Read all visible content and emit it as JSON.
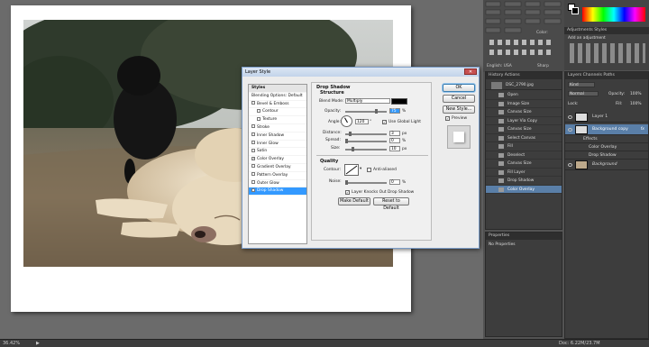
{
  "dialog": {
    "title": "Layer Style",
    "styles_header": "Styles",
    "style_items": [
      {
        "label": "Blending Options: Default",
        "checkbox": false,
        "checked": false,
        "sub": false,
        "active": false
      },
      {
        "label": "Bevel & Emboss",
        "checkbox": true,
        "checked": false,
        "sub": false,
        "active": false
      },
      {
        "label": "Contour",
        "checkbox": true,
        "checked": false,
        "sub": true,
        "active": false
      },
      {
        "label": "Texture",
        "checkbox": true,
        "checked": false,
        "sub": true,
        "active": false
      },
      {
        "label": "Stroke",
        "checkbox": true,
        "checked": false,
        "sub": false,
        "active": false
      },
      {
        "label": "Inner Shadow",
        "checkbox": true,
        "checked": false,
        "sub": false,
        "active": false
      },
      {
        "label": "Inner Glow",
        "checkbox": true,
        "checked": false,
        "sub": false,
        "active": false
      },
      {
        "label": "Satin",
        "checkbox": true,
        "checked": false,
        "sub": false,
        "active": false
      },
      {
        "label": "Color Overlay",
        "checkbox": true,
        "checked": true,
        "sub": false,
        "active": false
      },
      {
        "label": "Gradient Overlay",
        "checkbox": true,
        "checked": false,
        "sub": false,
        "active": false
      },
      {
        "label": "Pattern Overlay",
        "checkbox": true,
        "checked": false,
        "sub": false,
        "active": false
      },
      {
        "label": "Outer Glow",
        "checkbox": true,
        "checked": false,
        "sub": false,
        "active": false
      },
      {
        "label": "Drop Shadow",
        "checkbox": true,
        "checked": true,
        "sub": false,
        "active": true
      }
    ],
    "drop_shadow": {
      "group_title": "Drop Shadow",
      "structure_title": "Structure",
      "blend_mode_label": "Blend Mode:",
      "blend_mode_value": "Multiply",
      "opacity_label": "Opacity:",
      "opacity_value": "75",
      "opacity_unit": "%",
      "opacity_fraction": 0.75,
      "angle_label": "Angle:",
      "angle_value": "120",
      "angle_unit": "°",
      "use_global_light_label": "Use Global Light",
      "distance_label": "Distance:",
      "distance_value": "3",
      "distance_unit": "px",
      "distance_fraction": 0.1,
      "spread_label": "Spread:",
      "spread_value": "0",
      "spread_unit": "%",
      "size_label": "Size:",
      "size_value": "10",
      "size_unit": "px",
      "size_fraction": 0.15,
      "quality_title": "Quality",
      "contour_label": "Contour:",
      "anti_aliased_label": "Anti-aliased",
      "noise_label": "Noise:",
      "noise_value": "0",
      "noise_unit": "%",
      "knockout_label": "Layer Knocks Out Drop Shadow",
      "make_default": "Make Default",
      "reset_default": "Reset to Default"
    },
    "buttons": {
      "ok": "OK",
      "cancel": "Cancel",
      "new_style": "New Style...",
      "preview": "Preview"
    }
  },
  "history": {
    "tabs": "History   Actions",
    "snapshot": "DSC_2790.jpg",
    "items": [
      "Open",
      "Image Size",
      "Canvas Size",
      "Layer Via Copy",
      "Canvas Size",
      "Select Canvas",
      "Fill",
      "Deselect",
      "Canvas Size",
      "Fill Layer",
      "Drop Shadow",
      "Color Overlay"
    ],
    "selected_index": 11
  },
  "properties": {
    "tab": "Properties",
    "text": "No Properties"
  },
  "adjustments": {
    "tabs": "Adjustments   Styles",
    "title": "Add an adjustment"
  },
  "layers": {
    "tabs": "Layers   Channels   Paths",
    "kind_label": "Kind",
    "mode_value": "Normal",
    "opacity_label": "Opacity:",
    "opacity_value": "100%",
    "lock_label": "Lock:",
    "fill_label": "Fill:",
    "fill_value": "100%",
    "rows": [
      {
        "label": "Layer 1",
        "selected": false
      },
      {
        "label": "Background copy",
        "selected": true,
        "fx": "fx"
      },
      {
        "label": "Effects",
        "selected": false
      },
      {
        "label": "Color Overlay",
        "selected": false
      },
      {
        "label": "Drop Shadow",
        "selected": false
      },
      {
        "label": "Background",
        "selected": false
      }
    ]
  },
  "topbar": {
    "font_value": "English: USA",
    "aa_value": "Sharp",
    "color_label": "Color:"
  },
  "status": {
    "zoom": "36.42%",
    "doc": "Doc: 6.22M/23.7M",
    "arrow": "▶"
  },
  "colors": {
    "accent": "#3399ff",
    "selection": "#5a7fa8",
    "panel": "#3d3d3d",
    "dialog": "#ececec"
  }
}
